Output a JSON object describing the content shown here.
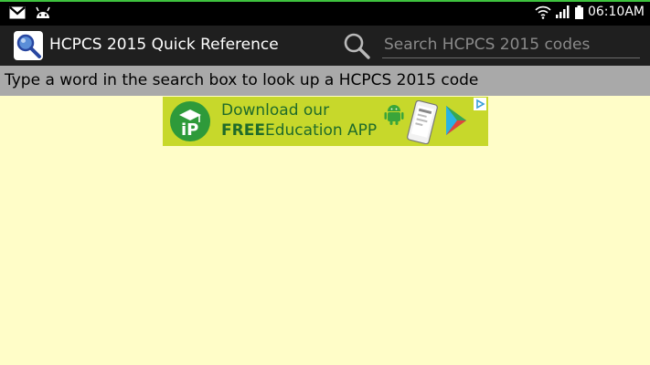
{
  "status_bar": {
    "time": "06:10AM",
    "notification_icons": [
      "gmail-icon",
      "android-icon"
    ],
    "indicator_icons": [
      "wifi-icon",
      "signal-icon",
      "battery-icon"
    ]
  },
  "action_bar": {
    "title": "HCPCS 2015 Quick Reference",
    "search_placeholder": "Search HCPCS 2015 codes"
  },
  "instruction": "Type a word in the search box to look up a HCPCS 2015 code",
  "ad": {
    "line1": "Download our",
    "free": "FREE",
    "line2": "Education APP"
  },
  "colors": {
    "background": "#fffdc8",
    "action_bar": "#1f1f1f",
    "instruction_bar": "#a9a9a9",
    "ad_background": "#c7d82b",
    "ad_text": "#1f6b2a"
  }
}
